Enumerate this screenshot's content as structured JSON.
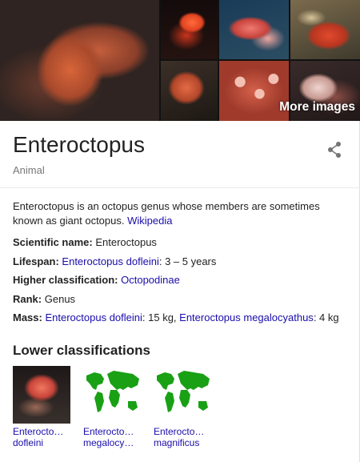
{
  "images": {
    "more_label": "More images"
  },
  "header": {
    "title": "Enteroctopus",
    "subtitle": "Animal"
  },
  "description": {
    "text": "Enteroctopus is an octopus genus whose members are sometimes known as giant octopus.",
    "source_link": "Wikipedia"
  },
  "facts": {
    "scientific_name": {
      "label": "Scientific name:",
      "value": "Enteroctopus"
    },
    "lifespan": {
      "label": "Lifespan:",
      "link": "Enteroctopus dofleini",
      "value": ": 3 – 5 years"
    },
    "higher_classification": {
      "label": "Higher classification:",
      "link": "Octopodinae"
    },
    "rank": {
      "label": "Rank:",
      "value": "Genus"
    },
    "mass": {
      "label": "Mass:",
      "link1": "Enteroctopus dofleini",
      "value1": ": 15 kg, ",
      "link2": "Enteroctopus megalocyathus",
      "value2": ": 4 kg"
    }
  },
  "lower_classifications": {
    "title": "Lower classifications",
    "items": [
      {
        "line1": "Enterocto…",
        "line2": "dofleini"
      },
      {
        "line1": "Enterocto…",
        "line2": "megalocy…"
      },
      {
        "line1": "Enterocto…",
        "line2": "magnificus"
      }
    ]
  },
  "colors": {
    "link": "#1a0dab",
    "text": "#222222",
    "muted": "#777777",
    "map_land": "#19a015"
  },
  "icons": {
    "share": "share-icon"
  }
}
